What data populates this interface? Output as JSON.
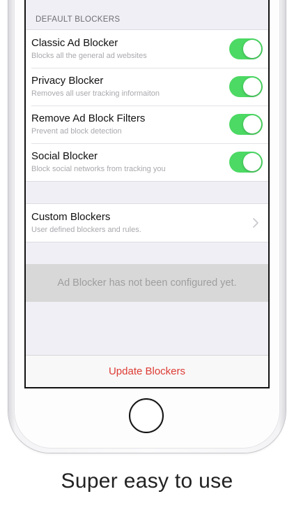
{
  "section_header": "DEFAULT BLOCKERS",
  "blockers": [
    {
      "title": "Classic Ad Blocker",
      "subtitle": "Blocks all the general ad websites",
      "enabled": true
    },
    {
      "title": "Privacy Blocker",
      "subtitle": "Removes all user tracking informaiton",
      "enabled": true
    },
    {
      "title": "Remove Ad Block Filters",
      "subtitle": "Prevent ad block detection",
      "enabled": true
    },
    {
      "title": "Social Blocker",
      "subtitle": "Block social networks from tracking you",
      "enabled": true
    }
  ],
  "custom": {
    "title": "Custom Blockers",
    "subtitle": "User defined blockers and rules.",
    "icon": "chevron-right-icon"
  },
  "status_message": "Ad Blocker has not been configured yet.",
  "update_button_label": "Update Blockers",
  "caption": "Super easy to use",
  "colors": {
    "toggle_on": "#4cd964",
    "action_red": "#dd3b34",
    "grouped_background": "#f0eff5"
  }
}
